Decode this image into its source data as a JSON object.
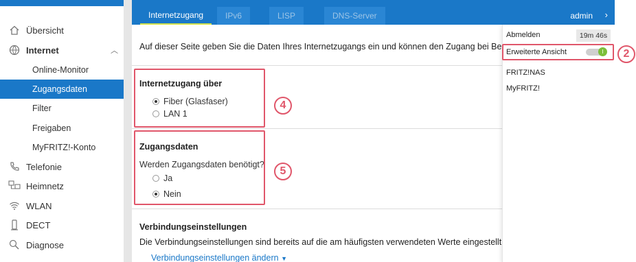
{
  "sidebar": {
    "items": [
      {
        "label": "Übersicht",
        "icon": "home-icon"
      },
      {
        "label": "Internet",
        "icon": "globe-icon"
      },
      {
        "label": "Online-Monitor"
      },
      {
        "label": "Zugangsdaten"
      },
      {
        "label": "Filter"
      },
      {
        "label": "Freigaben"
      },
      {
        "label": "MyFRITZ!-Konto"
      },
      {
        "label": "Telefonie",
        "icon": "phone-icon"
      },
      {
        "label": "Heimnetz",
        "icon": "network-icon"
      },
      {
        "label": "WLAN",
        "icon": "wifi-icon"
      },
      {
        "label": "DECT",
        "icon": "dect-icon"
      },
      {
        "label": "Diagnose",
        "icon": "diagnose-icon"
      }
    ]
  },
  "tabs": [
    "Internetzugang",
    "IPv6",
    "LISP",
    "DNS-Server"
  ],
  "user": {
    "name": "admin"
  },
  "menu": {
    "logout": "Abmelden",
    "session_time": "19m 46s",
    "advanced_view": "Erweiterte Ansicht",
    "toggle_state": "on",
    "fritznas": "FRITZ!NAS",
    "myfritz": "MyFRITZ!"
  },
  "main": {
    "intro": "Auf dieser Seite geben Sie die Daten Ihres Internetzugangs ein und können den Zugang bei Bedarf an besonde",
    "access": {
      "title": "Internetzugang über",
      "options": [
        "Fiber (Glasfaser)",
        "LAN 1"
      ],
      "selected": "Fiber (Glasfaser)"
    },
    "credentials": {
      "title": "Zugangsdaten",
      "question": "Werden Zugangsdaten benötigt?",
      "options": [
        "Ja",
        "Nein"
      ],
      "selected": "Nein"
    },
    "connection": {
      "title": "Verbindungseinstellungen",
      "text": "Die Verbindungseinstellungen sind bereits auf die am häufigsten verwendeten Werte eingestellt. Bei Bedarf können Sie diese Werte verändern.",
      "link": "Verbindungseinstellungen ändern"
    }
  },
  "annotations": [
    "2",
    "4",
    "5"
  ],
  "colors": {
    "accent": "#1a78c8",
    "highlight": "#e0566a",
    "toggle_on": "#7bbf3a"
  }
}
